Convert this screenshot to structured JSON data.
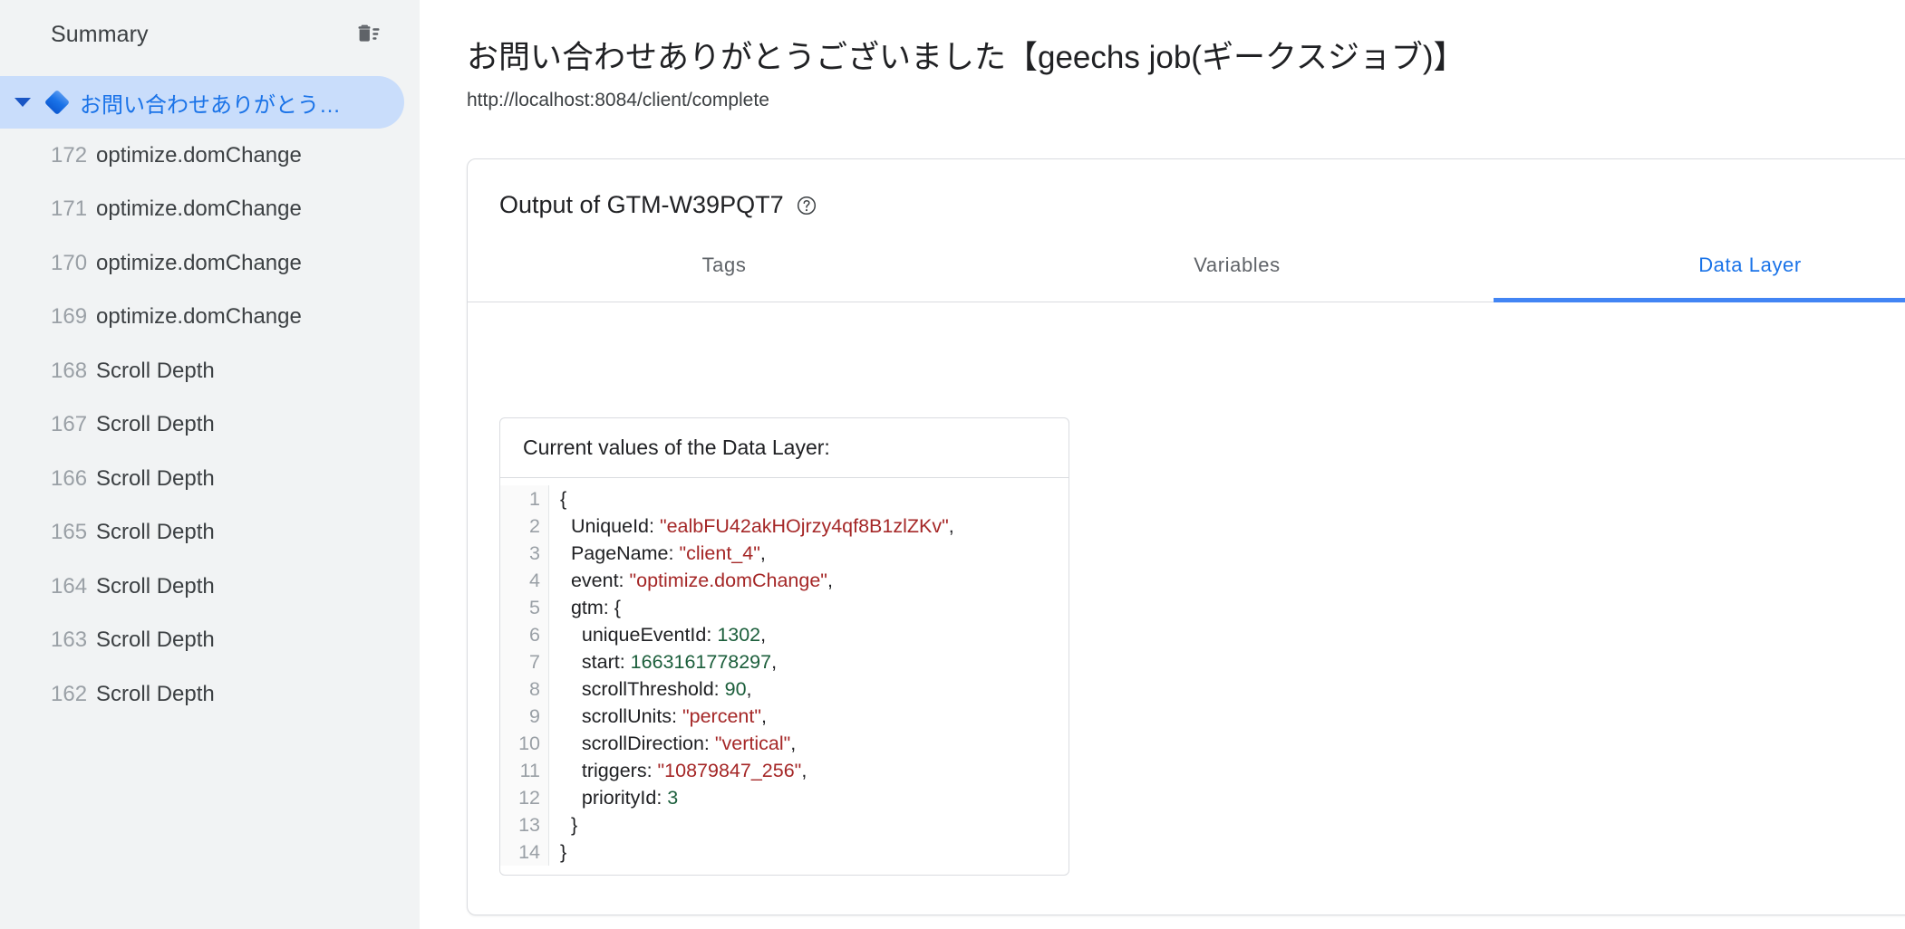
{
  "sidebar": {
    "title": "Summary",
    "clear_icon": "trash-icon",
    "summary_item": {
      "caret_icon": "caret-down-icon",
      "marker_icon": "diamond-icon",
      "label": "お問い合わせありがとう…"
    },
    "events": [
      {
        "num": "172",
        "name": "optimize.domChange"
      },
      {
        "num": "171",
        "name": "optimize.domChange"
      },
      {
        "num": "170",
        "name": "optimize.domChange"
      },
      {
        "num": "169",
        "name": "optimize.domChange"
      },
      {
        "num": "168",
        "name": "Scroll Depth"
      },
      {
        "num": "167",
        "name": "Scroll Depth"
      },
      {
        "num": "166",
        "name": "Scroll Depth"
      },
      {
        "num": "165",
        "name": "Scroll Depth"
      },
      {
        "num": "164",
        "name": "Scroll Depth"
      },
      {
        "num": "163",
        "name": "Scroll Depth"
      },
      {
        "num": "162",
        "name": "Scroll Depth"
      }
    ]
  },
  "header": {
    "title": "お問い合わせありがとうございました【geechs job(ギークスジョブ)】",
    "url": "http://localhost:8084/client/complete"
  },
  "output_card": {
    "title": "Output of GTM-W39PQT7",
    "help_icon": "help-circle-icon",
    "tabs": [
      {
        "label": "Tags",
        "active": false
      },
      {
        "label": "Variables",
        "active": false
      },
      {
        "label": "Data Layer",
        "active": true
      }
    ],
    "codebox": {
      "heading": "Current values of the Data Layer:",
      "line_numbers": [
        "1",
        "2",
        "3",
        "4",
        "5",
        "6",
        "7",
        "8",
        "9",
        "10",
        "11",
        "12",
        "13",
        "14"
      ],
      "lines": [
        "{",
        "  UniqueId: \"ealbFU42akHOjrzy4qf8B1zlZKv\",",
        "  PageName: \"client_4\",",
        "  event: \"optimize.domChange\",",
        "  gtm: {",
        "    uniqueEventId: 1302,",
        "    start: 1663161778297,",
        "    scrollThreshold: 90,",
        "    scrollUnits: \"percent\",",
        "    scrollDirection: \"vertical\",",
        "    triggers: \"10879847_256\",",
        "    priorityId: 3",
        "  }",
        "}"
      ]
    }
  },
  "colors": {
    "accent": "#1a73e8",
    "tab_underline": "#4285f4",
    "sidebar_bg": "#f1f3f4",
    "selected_row": "#c9ddfb",
    "string_token": "#a52727",
    "number_token": "#1b5e3b"
  }
}
